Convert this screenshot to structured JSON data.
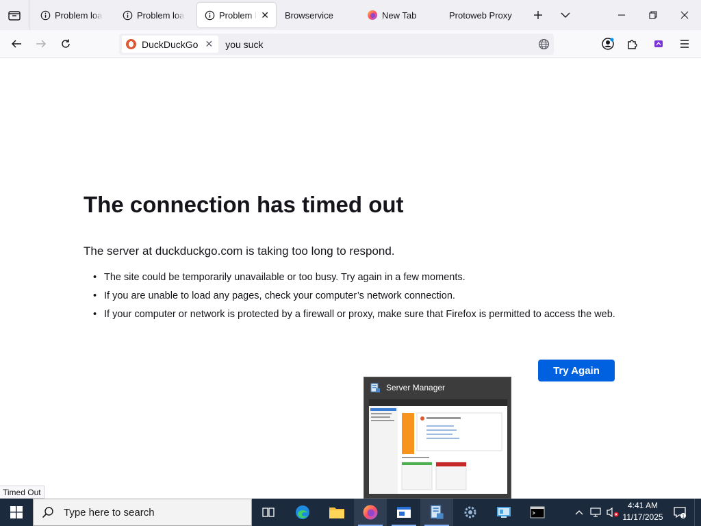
{
  "browser": {
    "tabs": [
      {
        "label": "Problem loadi",
        "icon": "info-icon",
        "active": false
      },
      {
        "label": "Problem loadi",
        "icon": "info-icon",
        "active": false
      },
      {
        "label": "Problem lo",
        "icon": "info-icon",
        "active": true
      },
      {
        "label": "Browservice",
        "icon": "",
        "active": false
      },
      {
        "label": "New Tab",
        "icon": "firefox-icon",
        "active": false
      },
      {
        "label": "Protoweb Proxy",
        "icon": "",
        "active": false
      }
    ],
    "url_bar": {
      "search_engine": "DuckDuckGo",
      "value": "you suck"
    }
  },
  "error_page": {
    "title": "The connection has timed out",
    "description": "The server at duckduckgo.com is taking too long to respond.",
    "bullets": [
      "The site could be temporarily unavailable or too busy. Try again in a few moments.",
      "If you are unable to load any pages, check your computer’s network connection.",
      "If your computer or network is protected by a firewall or proxy, make sure that Firefox is permitted to access the web."
    ],
    "try_again_label": "Try Again"
  },
  "status_tooltip": "Timed Out",
  "thumbnail": {
    "title": "Server Manager"
  },
  "taskbar": {
    "search_placeholder": "Type here to search",
    "clock_time": "4:41 AM",
    "clock_date": "11/17/2025"
  },
  "colors": {
    "accent": "#0061e0",
    "taskbar": "#1b2a3d"
  }
}
